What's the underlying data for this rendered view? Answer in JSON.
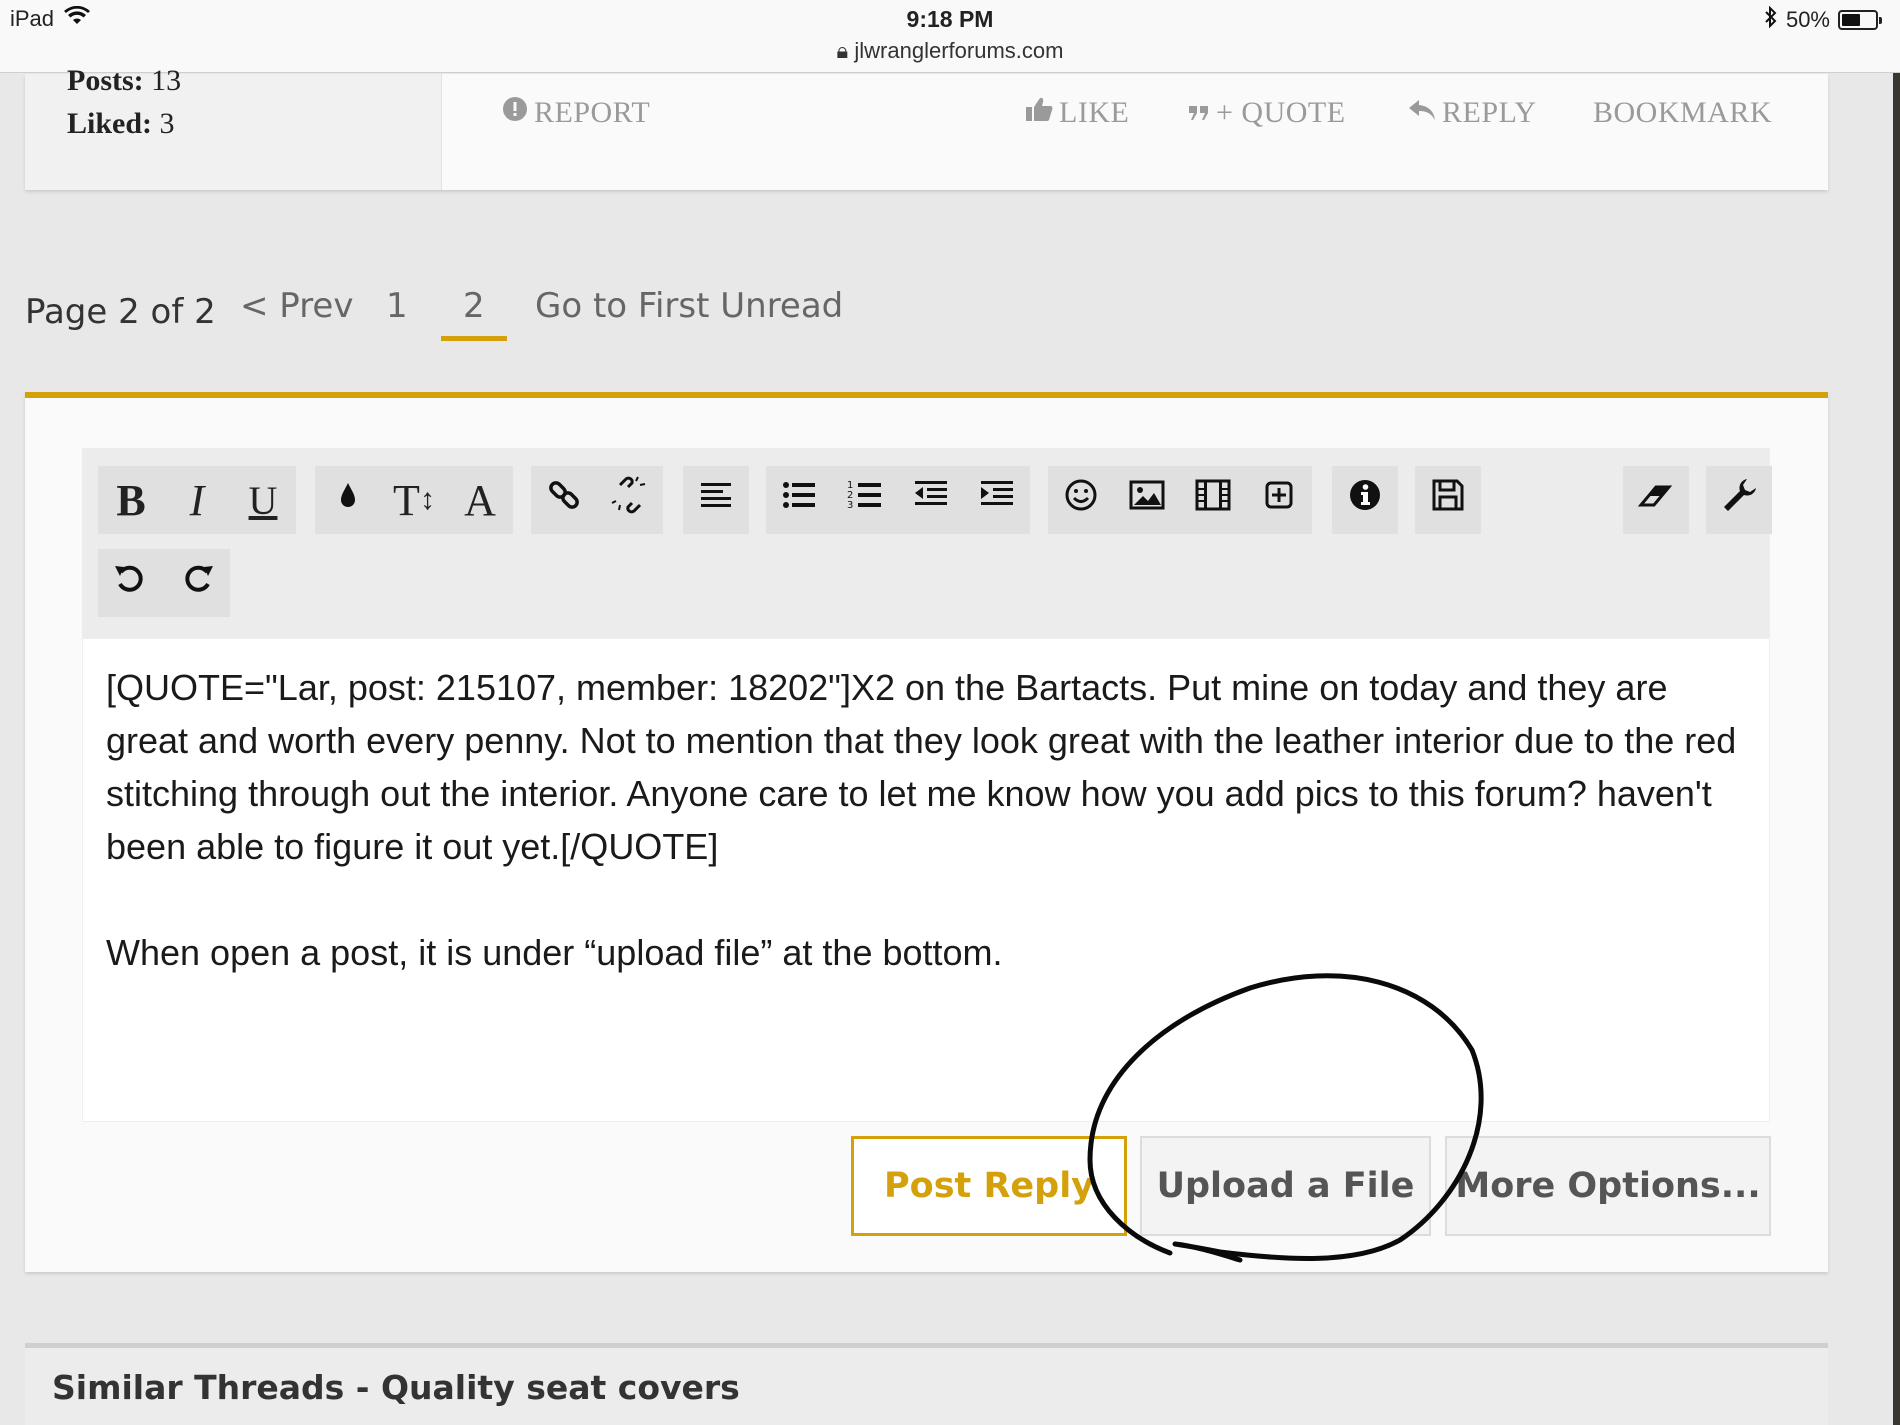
{
  "status_bar": {
    "device": "iPad",
    "time": "9:18 PM",
    "url": "jlwranglerforums.com",
    "battery": "50%"
  },
  "post": {
    "posts_label": "Posts:",
    "posts_value": "13",
    "liked_label": "Liked:",
    "liked_value": "3",
    "actions": {
      "report": "REPORT",
      "like": "LIKE",
      "quote": "+ QUOTE",
      "reply": "REPLY",
      "bookmark": "BOOKMARK"
    }
  },
  "pagination": {
    "label": "Page 2 of 2",
    "prev": "< Prev",
    "pages": [
      "1",
      "2"
    ],
    "current_page": "2",
    "first_unread": "Go to First Unread"
  },
  "toolbar": {
    "bold": "B",
    "italic": "I",
    "underline": "U",
    "font_size": "T",
    "font_family": "A"
  },
  "editor": {
    "paragraph_1": "[QUOTE=\"Lar, post: 215107, member: 18202\"]X2 on the Bartacts. Put mine on today and they are great and worth every penny. Not to mention that they look great with the leather interior due to the red stitching through out the interior.  Anyone care to let me know how you add pics to this forum? haven't been able to figure it out yet.[/QUOTE]",
    "paragraph_2": "When open a post, it is under “upload file” at the bottom."
  },
  "buttons": {
    "post_reply": "Post Reply",
    "upload_file": "Upload a File",
    "more_options": "More Options..."
  },
  "similar_threads": {
    "title": "Similar Threads - Quality seat covers"
  },
  "colors": {
    "accent": "#d4a10b",
    "background": "#e8e8e8",
    "panel": "#fafafa"
  }
}
